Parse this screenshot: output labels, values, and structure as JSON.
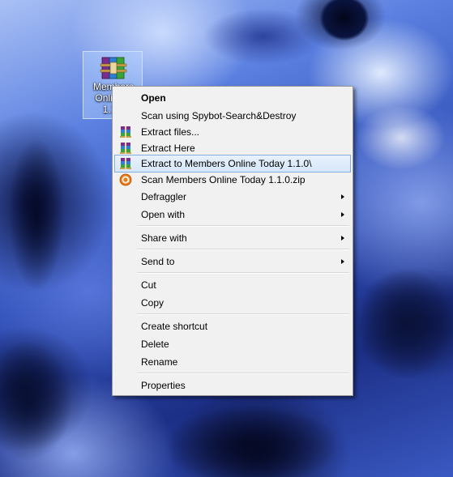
{
  "desktop": {
    "icon": {
      "name": "winrar-archive-icon",
      "label_lines": [
        "Members",
        "Online T",
        "1.1.0"
      ]
    }
  },
  "context_menu": {
    "items": [
      {
        "label": "Open",
        "bold": true
      },
      {
        "label": "Scan using Spybot-Search&Destroy"
      },
      {
        "label": "Extract files...",
        "icon": "winrar-icon"
      },
      {
        "label": "Extract Here",
        "icon": "winrar-icon"
      },
      {
        "label": "Extract to Members Online Today 1.1.0\\",
        "icon": "winrar-icon",
        "highlighted": true
      },
      {
        "label": "Scan Members Online Today 1.1.0.zip",
        "icon": "avast-icon"
      },
      {
        "label": "Defraggler",
        "submenu": true
      },
      {
        "label": "Open with",
        "submenu": true
      },
      {
        "label": "Share with",
        "submenu": true
      },
      {
        "label": "Send to",
        "submenu": true
      },
      {
        "label": "Cut"
      },
      {
        "label": "Copy"
      },
      {
        "label": "Create shortcut"
      },
      {
        "label": "Delete"
      },
      {
        "label": "Rename"
      },
      {
        "label": "Properties"
      }
    ]
  },
  "colors": {
    "highlight_border": "#84acdd",
    "menu_background": "#f1f1f1"
  }
}
